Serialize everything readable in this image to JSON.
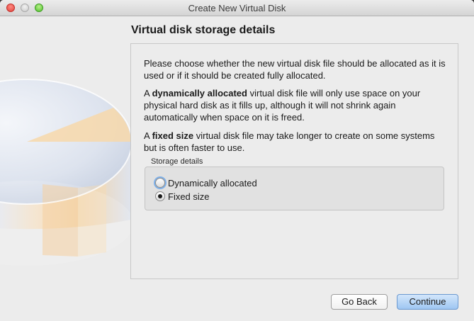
{
  "window": {
    "title": "Create New Virtual Disk"
  },
  "page": {
    "heading": "Virtual disk storage details",
    "intro": "Please choose whether the new virtual disk file should be allocated as it is used or if it should be created fully allocated.",
    "dynamic_description": {
      "prefix": "A ",
      "emphasis": "dynamically allocated",
      "suffix": " virtual disk file will only use space on your physical hard disk as it fills up, although it will not shrink again automatically when space on it is freed."
    },
    "fixed_description": {
      "prefix": "A ",
      "emphasis": "fixed size",
      "suffix": " virtual disk file may take longer to create on some systems but is often faster to use."
    }
  },
  "storage_details": {
    "group_label": "Storage details",
    "options": [
      {
        "label": "Dynamically allocated",
        "selected": false
      },
      {
        "label": "Fixed size",
        "selected": true
      }
    ]
  },
  "buttons": {
    "back": "Go Back",
    "continue": "Continue"
  }
}
